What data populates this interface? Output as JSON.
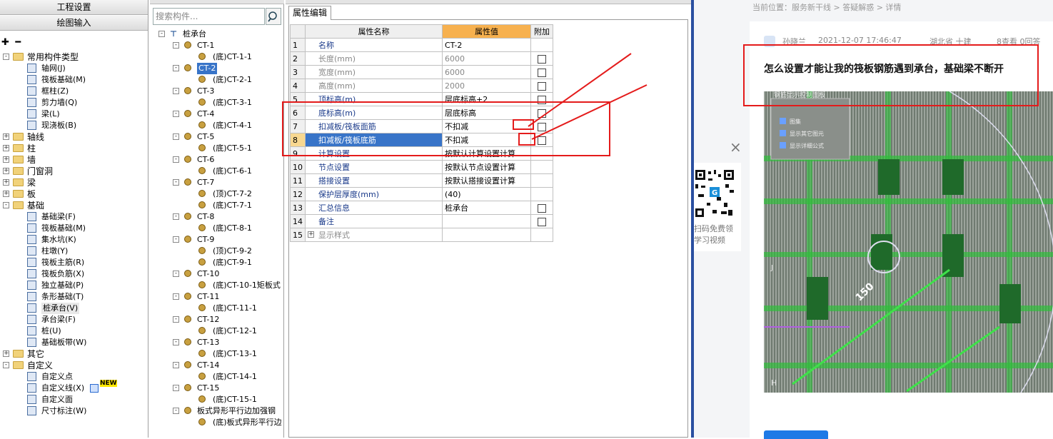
{
  "left_panel": {
    "header1": "工程设置",
    "header2": "绘图输入",
    "tree": [
      {
        "label": "常用构件类型",
        "level": 0,
        "expand": "-",
        "folder": true
      },
      {
        "label": "轴网(J)",
        "level": 1
      },
      {
        "label": "筏板基础(M)",
        "level": 1
      },
      {
        "label": "框柱(Z)",
        "level": 1
      },
      {
        "label": "剪力墙(Q)",
        "level": 1
      },
      {
        "label": "梁(L)",
        "level": 1
      },
      {
        "label": "现浇板(B)",
        "level": 1
      },
      {
        "label": "轴线",
        "level": 0,
        "expand": "+",
        "folder": true
      },
      {
        "label": "柱",
        "level": 0,
        "expand": "+",
        "folder": true
      },
      {
        "label": "墙",
        "level": 0,
        "expand": "+",
        "folder": true
      },
      {
        "label": "门窗洞",
        "level": 0,
        "expand": "+",
        "folder": true
      },
      {
        "label": "梁",
        "level": 0,
        "expand": "+",
        "folder": true
      },
      {
        "label": "板",
        "level": 0,
        "expand": "+",
        "folder": true
      },
      {
        "label": "基础",
        "level": 0,
        "expand": "-",
        "folder": true
      },
      {
        "label": "基础梁(F)",
        "level": 1
      },
      {
        "label": "筏板基础(M)",
        "level": 1
      },
      {
        "label": "集水坑(K)",
        "level": 1
      },
      {
        "label": "柱墩(Y)",
        "level": 1
      },
      {
        "label": "筏板主筋(R)",
        "level": 1
      },
      {
        "label": "筏板负筋(X)",
        "level": 1
      },
      {
        "label": "独立基础(P)",
        "level": 1
      },
      {
        "label": "条形基础(T)",
        "level": 1
      },
      {
        "label": "桩承台(V)",
        "level": 1,
        "selected": true
      },
      {
        "label": "承台梁(F)",
        "level": 1
      },
      {
        "label": "桩(U)",
        "level": 1
      },
      {
        "label": "基础板带(W)",
        "level": 1
      },
      {
        "label": "其它",
        "level": 0,
        "expand": "+",
        "folder": true
      },
      {
        "label": "自定义",
        "level": 0,
        "expand": "-",
        "folder": true
      },
      {
        "label": "自定义点",
        "level": 1
      },
      {
        "label": "自定义线(X)",
        "level": 1,
        "badge": "NEW"
      },
      {
        "label": "自定义面",
        "level": 1
      },
      {
        "label": "尺寸标注(W)",
        "level": 1
      }
    ]
  },
  "middle_panel": {
    "search_placeholder": "搜索构件...",
    "root": "桩承台",
    "nodes": [
      {
        "label": "CT-1",
        "level": 1
      },
      {
        "label": "(底)CT-1-1",
        "level": 2
      },
      {
        "label": "CT-2",
        "level": 1,
        "selected": true
      },
      {
        "label": "(底)CT-2-1",
        "level": 2
      },
      {
        "label": "CT-3",
        "level": 1
      },
      {
        "label": "(底)CT-3-1",
        "level": 2
      },
      {
        "label": "CT-4",
        "level": 1
      },
      {
        "label": "(底)CT-4-1",
        "level": 2
      },
      {
        "label": "CT-5",
        "level": 1
      },
      {
        "label": "(底)CT-5-1",
        "level": 2
      },
      {
        "label": "CT-6",
        "level": 1
      },
      {
        "label": "(底)CT-6-1",
        "level": 2
      },
      {
        "label": "CT-7",
        "level": 1
      },
      {
        "label": "(顶)CT-7-2",
        "level": 2
      },
      {
        "label": "(底)CT-7-1",
        "level": 2
      },
      {
        "label": "CT-8",
        "level": 1
      },
      {
        "label": "(底)CT-8-1",
        "level": 2
      },
      {
        "label": "CT-9",
        "level": 1
      },
      {
        "label": "(顶)CT-9-2",
        "level": 2
      },
      {
        "label": "(底)CT-9-1",
        "level": 2
      },
      {
        "label": "CT-10",
        "level": 1
      },
      {
        "label": "(底)CT-10-1矩板式",
        "level": 2
      },
      {
        "label": "CT-11",
        "level": 1
      },
      {
        "label": "(底)CT-11-1",
        "level": 2
      },
      {
        "label": "CT-12",
        "level": 1
      },
      {
        "label": "(底)CT-12-1",
        "level": 2
      },
      {
        "label": "CT-13",
        "level": 1
      },
      {
        "label": "(底)CT-13-1",
        "level": 2
      },
      {
        "label": "CT-14",
        "level": 1
      },
      {
        "label": "(底)CT-14-1",
        "level": 2
      },
      {
        "label": "CT-15",
        "level": 1
      },
      {
        "label": "(底)CT-15-1",
        "level": 2
      },
      {
        "label": "板式异形平行边加强钢",
        "level": 1
      },
      {
        "label": "(底)板式异形平行边",
        "level": 2
      }
    ]
  },
  "property_editor": {
    "tab": "属性编辑",
    "headers": {
      "num": "",
      "name": "属性名称",
      "value": "属性值",
      "add": "附加"
    },
    "rows": [
      {
        "num": "1",
        "name": "名称",
        "value": "CT-2",
        "gray": false,
        "check": false
      },
      {
        "num": "2",
        "name": "长度(mm)",
        "value": "6000",
        "gray": true,
        "check": true
      },
      {
        "num": "3",
        "name": "宽度(mm)",
        "value": "6000",
        "gray": true,
        "check": true
      },
      {
        "num": "4",
        "name": "高度(mm)",
        "value": "2000",
        "gray": true,
        "check": true
      },
      {
        "num": "5",
        "name": "顶标高(m)",
        "value": "层底标高+2",
        "gray": false,
        "check": true
      },
      {
        "num": "6",
        "name": "底标高(m)",
        "value": "层底标高",
        "gray": false,
        "check": true
      },
      {
        "num": "7",
        "name": "扣减板/筏板面筋",
        "value": "不扣减",
        "gray": false,
        "check": true
      },
      {
        "num": "8",
        "name": "扣减板/筏板底筋",
        "value": "不扣减",
        "gray": false,
        "check": true,
        "selected": true
      },
      {
        "num": "9",
        "name": "计算设置",
        "value": "按默认计算设置计算",
        "gray": false,
        "check": false
      },
      {
        "num": "10",
        "name": "节点设置",
        "value": "按默认节点设置计算",
        "gray": false,
        "check": false
      },
      {
        "num": "11",
        "name": "搭接设置",
        "value": "按默认搭接设置计算",
        "gray": false,
        "check": false
      },
      {
        "num": "12",
        "name": "保护层厚度(mm)",
        "value": "(40)",
        "gray": false,
        "check": false
      },
      {
        "num": "13",
        "name": "汇总信息",
        "value": "桩承台",
        "gray": false,
        "check": true
      },
      {
        "num": "14",
        "name": "备注",
        "value": "",
        "gray": false,
        "check": true
      },
      {
        "num": "15",
        "name": "显示样式",
        "value": "",
        "gray": true,
        "check": false,
        "expand": "+"
      }
    ]
  },
  "web_panel": {
    "breadcrumb": "当前位置：服务新干线 > 答疑解惑 > 详情",
    "author": "孙晓兰",
    "datetime": "2021-12-07 17:46:47",
    "location": "湖北省 十建",
    "stats": "8查看 0回答",
    "question": "怎么设置才能让我的筏板钢筋遇到承台，基础梁不断开",
    "qr_text1": "扫码免费领",
    "qr_text2": "学习视频",
    "close_glyph": "×",
    "screenshot_panel_title": "钢筋显示控制面板",
    "screenshot_checks": [
      "图集",
      "显示其它图元",
      "显示详细公式"
    ],
    "screenshot_label": "150",
    "screenshot_axis_j": "J",
    "screenshot_axis_h": "H"
  },
  "colors": {
    "selected_blue": "#3874c8",
    "header_orange": "#f7b14f",
    "annotation_red": "#e41b1b",
    "cad_green": "#2fbf3a"
  }
}
